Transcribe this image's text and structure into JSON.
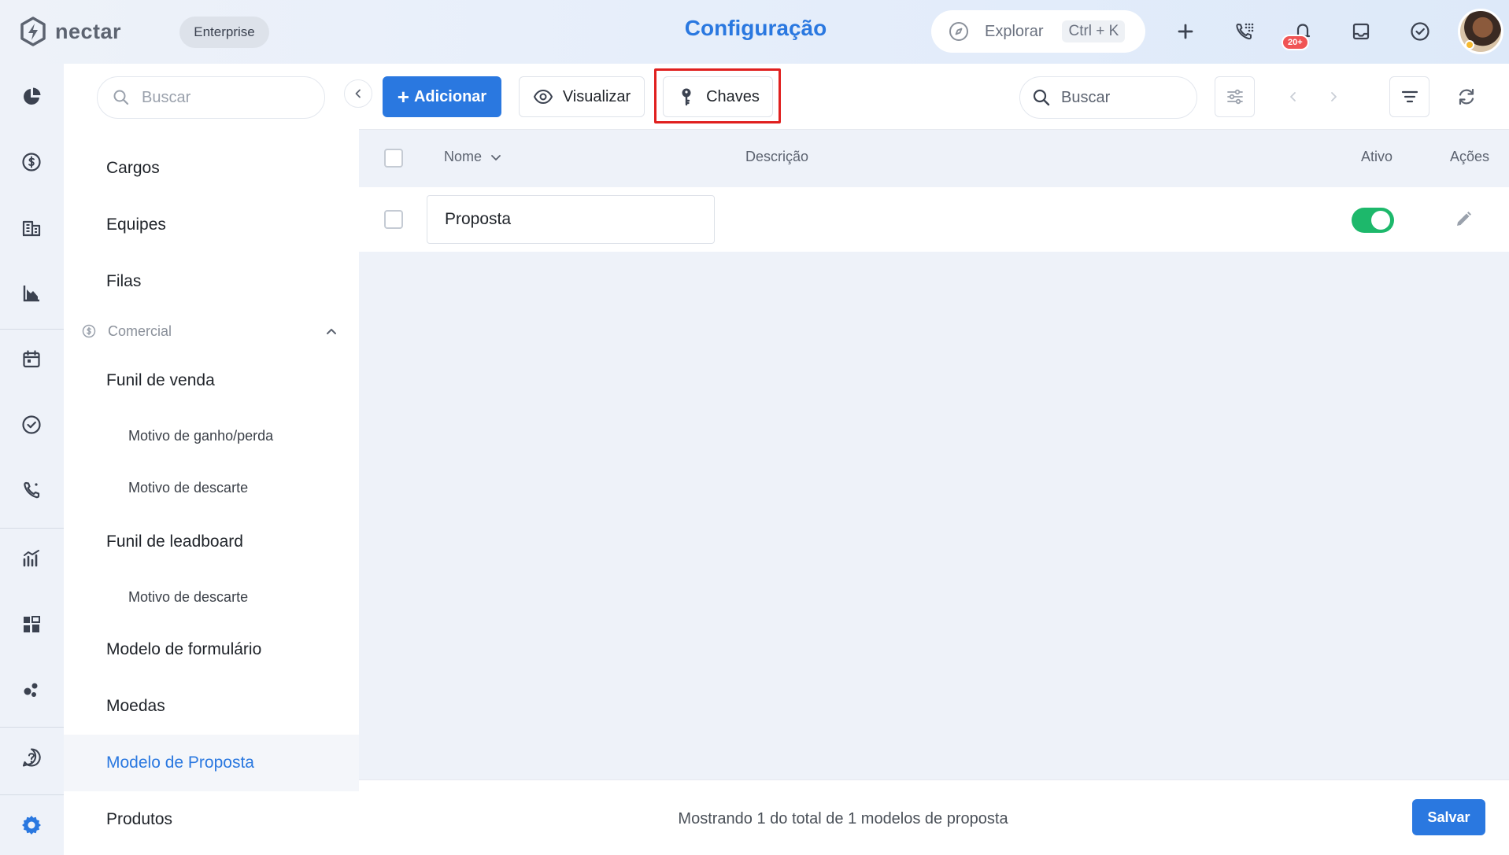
{
  "app": {
    "brand": "nectar",
    "plan_badge": "Enterprise",
    "page_title": "Configuração"
  },
  "header": {
    "explore_label": "Explorar",
    "explore_shortcut": "Ctrl + K",
    "notification_count": "20+",
    "icons": [
      "compass-icon",
      "plus-icon",
      "phone-dialpad-icon",
      "bell-icon",
      "inbox-icon",
      "check-circle-icon"
    ]
  },
  "rail": {
    "icons": [
      "pie-chart-icon",
      "dollar-icon",
      "building-icon",
      "chart-down-icon",
      "calendar-icon",
      "check-circle-icon",
      "phone-icon",
      "analytics-icon",
      "dashboard-icon",
      "bubbles-icon",
      "help-icon",
      "gear-icon"
    ]
  },
  "sidebar": {
    "search_placeholder": "Buscar",
    "items": [
      {
        "label": "Cargos"
      },
      {
        "label": "Equipes"
      },
      {
        "label": "Filas"
      },
      {
        "label": "Comercial"
      },
      {
        "label": "Funil de venda"
      },
      {
        "label": "Motivo de ganho/perda"
      },
      {
        "label": "Motivo de descarte"
      },
      {
        "label": "Funil de leadboard"
      },
      {
        "label": "Motivo de descarte"
      },
      {
        "label": "Modelo de formulário"
      },
      {
        "label": "Moedas"
      },
      {
        "label": "Modelo de Proposta"
      },
      {
        "label": "Produtos"
      }
    ]
  },
  "toolbar": {
    "add_label": "Adicionar",
    "view_label": "Visualizar",
    "keys_label": "Chaves",
    "search_placeholder": "Buscar"
  },
  "table": {
    "columns": [
      "Nome",
      "Descrição",
      "Ativo",
      "Ações"
    ],
    "rows": [
      {
        "name": "Proposta",
        "description": "",
        "active": true
      }
    ]
  },
  "footer": {
    "summary": "Mostrando 1 do total de 1 modelos de proposta",
    "save_label": "Salvar"
  },
  "colors": {
    "accent": "#2a78e0",
    "toggle_on": "#1db86b",
    "highlight": "#e0201f",
    "badge": "#f05454"
  }
}
